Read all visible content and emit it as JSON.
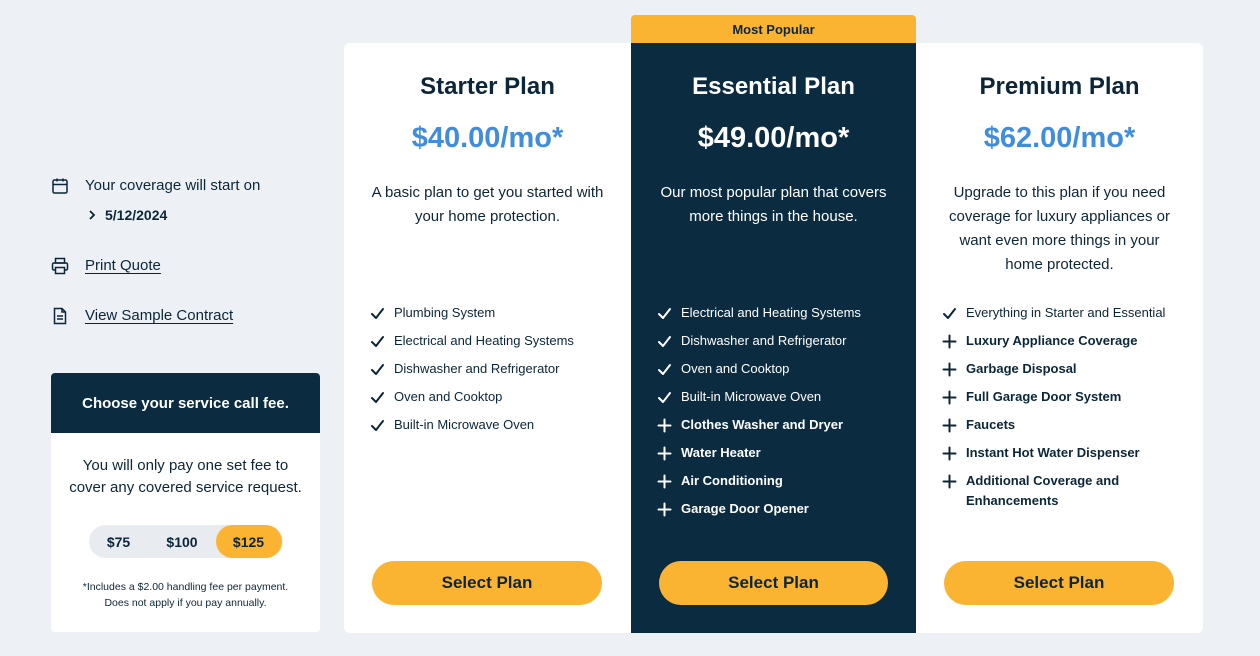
{
  "coverage": {
    "label": "Your coverage will start on",
    "date": "5/12/2024"
  },
  "links": {
    "print_quote": "Print Quote",
    "view_contract": "View Sample Contract"
  },
  "fee_card": {
    "title": "Choose your service call fee.",
    "description": "You will only pay one set fee to cover any covered service request.",
    "options": [
      "$75",
      "$100",
      "$125"
    ],
    "selected": "$125",
    "note_line1": "*Includes a $2.00 handling fee per payment.",
    "note_line2": "Does not apply if you pay annually."
  },
  "popular_badge": "Most Popular",
  "plans": [
    {
      "name": "Starter Plan",
      "price": "$40.00/mo*",
      "description": "A basic plan to get you started with your home protection.",
      "features": [
        {
          "icon": "check-icon",
          "text": "Plumbing System",
          "bold": false
        },
        {
          "icon": "check-icon",
          "text": "Electrical and Heating Systems",
          "bold": false
        },
        {
          "icon": "check-icon",
          "text": "Dishwasher and Refrigerator",
          "bold": false
        },
        {
          "icon": "check-icon",
          "text": "Oven and Cooktop",
          "bold": false
        },
        {
          "icon": "check-icon",
          "text": "Built-in Microwave Oven",
          "bold": false
        }
      ],
      "button": "Select Plan"
    },
    {
      "name": "Essential Plan",
      "price": "$49.00/mo*",
      "description": "Our most popular plan that covers more things in the house.",
      "features": [
        {
          "icon": "check-icon",
          "text": "Electrical and Heating Systems",
          "bold": false
        },
        {
          "icon": "check-icon",
          "text": "Dishwasher and Refrigerator",
          "bold": false
        },
        {
          "icon": "check-icon",
          "text": "Oven and Cooktop",
          "bold": false
        },
        {
          "icon": "check-icon",
          "text": "Built-in Microwave Oven",
          "bold": false
        },
        {
          "icon": "plus-icon",
          "text": "Clothes Washer and Dryer",
          "bold": true
        },
        {
          "icon": "plus-icon",
          "text": "Water Heater",
          "bold": true
        },
        {
          "icon": "plus-icon",
          "text": "Air Conditioning",
          "bold": true
        },
        {
          "icon": "plus-icon",
          "text": "Garage Door Opener",
          "bold": true
        }
      ],
      "button": "Select Plan"
    },
    {
      "name": "Premium Plan",
      "price": "$62.00/mo*",
      "description": "Upgrade to this plan if you need coverage for luxury appliances or want even more things in your home protected.",
      "features": [
        {
          "icon": "check-icon",
          "text": "Everything in Starter and Essential",
          "bold": false
        },
        {
          "icon": "plus-icon",
          "text": "Luxury Appliance Coverage",
          "bold": true
        },
        {
          "icon": "plus-icon",
          "text": "Garbage Disposal",
          "bold": true
        },
        {
          "icon": "plus-icon",
          "text": "Full Garage Door System",
          "bold": true
        },
        {
          "icon": "plus-icon",
          "text": "Faucets",
          "bold": true
        },
        {
          "icon": "plus-icon",
          "text": "Instant Hot Water Dispenser",
          "bold": true
        },
        {
          "icon": "plus-icon",
          "text": "Additional Coverage and Enhancements",
          "bold": true
        }
      ],
      "button": "Select Plan"
    }
  ],
  "colors": {
    "page_bg": "#edf1f5",
    "navy": "#0b2b40",
    "accent_yellow": "#fbb431",
    "price_blue": "#3f8ddb"
  }
}
